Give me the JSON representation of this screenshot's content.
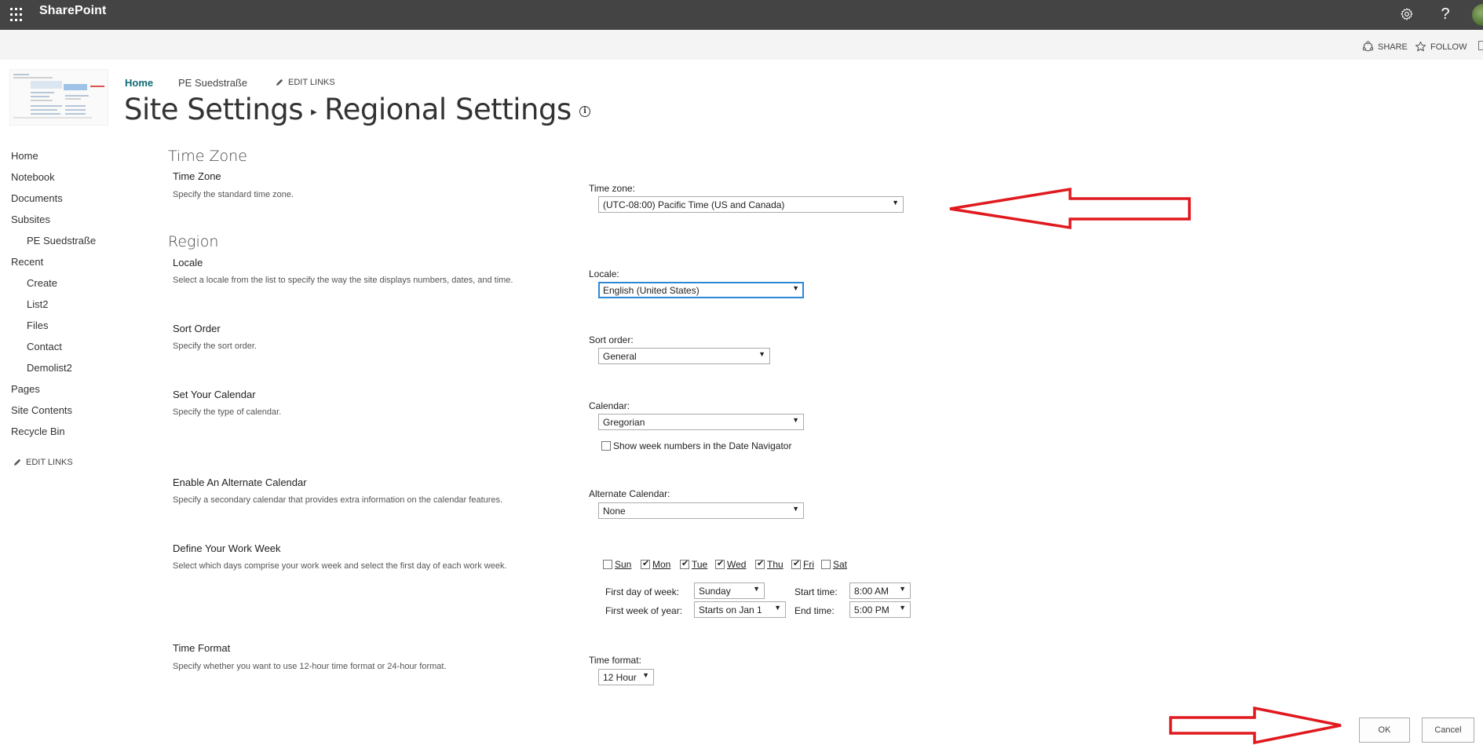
{
  "suitebar": {
    "app_name": "SharePoint",
    "icons": [
      "app-launcher-icon",
      "gear-icon",
      "help-icon",
      "avatar"
    ]
  },
  "commandbar": {
    "share": "SHARE",
    "follow": "FOLLOW"
  },
  "header": {
    "topnav": [
      "Home",
      "PE Suedstraße"
    ],
    "edit_links": "EDIT LINKS",
    "breadcrumb_parent": "Site Settings",
    "breadcrumb_current": "Regional Settings",
    "info_glyph": "i"
  },
  "leftnav": {
    "items": [
      {
        "label": "Home",
        "level": 0
      },
      {
        "label": "Notebook",
        "level": 0
      },
      {
        "label": "Documents",
        "level": 0
      },
      {
        "label": "Subsites",
        "level": 0
      },
      {
        "label": "PE Suedstraße",
        "level": 1
      },
      {
        "label": "Recent",
        "level": 0
      },
      {
        "label": "Create",
        "level": 1
      },
      {
        "label": "List2",
        "level": 1
      },
      {
        "label": "Files",
        "level": 1
      },
      {
        "label": "Contact",
        "level": 1
      },
      {
        "label": "Demolist2",
        "level": 1
      },
      {
        "label": "Pages",
        "level": 0
      },
      {
        "label": "Site Contents",
        "level": 0
      },
      {
        "label": "Recycle Bin",
        "level": 0
      }
    ],
    "edit_links": "EDIT LINKS"
  },
  "sections": {
    "time_zone_heading": "Time Zone",
    "region_heading": "Region"
  },
  "settings": {
    "time_zone": {
      "title": "Time Zone",
      "desc": "Specify the standard time zone.",
      "label": "Time zone:",
      "value": "(UTC-08:00) Pacific Time (US and Canada)"
    },
    "locale": {
      "title": "Locale",
      "desc": "Select a locale from the list to specify the way the site displays numbers, dates, and time.",
      "label": "Locale:",
      "value": "English (United States)"
    },
    "sort_order": {
      "title": "Sort Order",
      "desc": "Specify the sort order.",
      "label": "Sort order:",
      "value": "General"
    },
    "calendar": {
      "title": "Set Your Calendar",
      "desc": "Specify the type of calendar.",
      "label": "Calendar:",
      "value": "Gregorian",
      "week_numbers_label": "Show week numbers in the Date Navigator",
      "week_numbers_checked": false
    },
    "alternate_calendar": {
      "title": "Enable An Alternate Calendar",
      "desc": "Specify a secondary calendar that provides extra information on the calendar features.",
      "label": "Alternate Calendar:",
      "value": "None"
    },
    "work_week": {
      "title": "Define Your Work Week",
      "desc": "Select which days comprise your work week and select the first day of each work week.",
      "days": [
        {
          "label": "Sun",
          "checked": false
        },
        {
          "label": "Mon",
          "checked": true
        },
        {
          "label": "Tue",
          "checked": true
        },
        {
          "label": "Wed",
          "checked": true
        },
        {
          "label": "Thu",
          "checked": true
        },
        {
          "label": "Fri",
          "checked": true
        },
        {
          "label": "Sat",
          "checked": false
        }
      ],
      "first_day_label": "First day of week:",
      "first_day_value": "Sunday",
      "first_week_label": "First week of year:",
      "first_week_value": "Starts on Jan 1",
      "start_time_label": "Start time:",
      "start_time_value": "8:00 AM",
      "end_time_label": "End time:",
      "end_time_value": "5:00 PM"
    },
    "time_format": {
      "title": "Time Format",
      "desc": "Specify whether you want to use 12-hour time format or 24-hour format.",
      "label": "Time format:",
      "value": "12 Hour"
    }
  },
  "buttons": {
    "ok": "OK",
    "cancel": "Cancel"
  },
  "annotation_color": "#e0191e"
}
